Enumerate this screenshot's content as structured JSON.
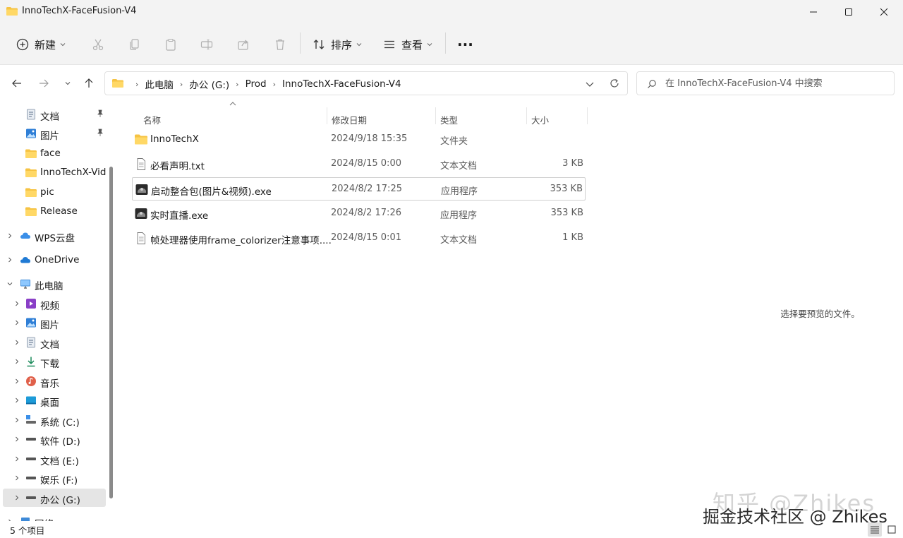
{
  "window": {
    "title": "InnoTechX-FaceFusion-V4",
    "minimize_icon": "minimize-icon",
    "maximize_icon": "maximize-icon",
    "close_icon": "close-icon"
  },
  "toolbar": {
    "new_label": "新建",
    "sort_label": "排序",
    "view_label": "查看",
    "more_label": "···"
  },
  "address": {
    "crumbs": [
      "此电脑",
      "办公 (G:)",
      "Prod",
      "InnoTechX-FaceFusion-V4"
    ],
    "search_placeholder": "在 InnoTechX-FaceFusion-V4 中搜索"
  },
  "sidebar": {
    "quick": [
      {
        "label": "文档",
        "icon": "documents-icon",
        "pinned": true
      },
      {
        "label": "图片",
        "icon": "pictures-icon",
        "pinned": true
      },
      {
        "label": "face",
        "icon": "folder-icon"
      },
      {
        "label": "InnoTechX-Vid",
        "icon": "folder-icon"
      },
      {
        "label": "pic",
        "icon": "folder-icon"
      },
      {
        "label": "Release",
        "icon": "folder-icon"
      }
    ],
    "wps": "WPS云盘",
    "onedrive": "OneDrive",
    "thispc": "此电脑",
    "pc_items": [
      {
        "label": "视频",
        "icon": "videos-icon"
      },
      {
        "label": "图片",
        "icon": "pictures-icon"
      },
      {
        "label": "文档",
        "icon": "documents-icon"
      },
      {
        "label": "下载",
        "icon": "downloads-icon"
      },
      {
        "label": "音乐",
        "icon": "music-icon"
      },
      {
        "label": "桌面",
        "icon": "desktop-icon"
      },
      {
        "label": "系统 (C:)",
        "icon": "system-drive-icon"
      },
      {
        "label": "软件 (D:)",
        "icon": "drive-icon"
      },
      {
        "label": "文档 (E:)",
        "icon": "drive-icon"
      },
      {
        "label": "娱乐 (F:)",
        "icon": "drive-icon"
      },
      {
        "label": "办公 (G:)",
        "icon": "drive-icon",
        "selected": true
      },
      {
        "label": "网络",
        "icon": "network-icon"
      }
    ]
  },
  "columns": {
    "name": "名称",
    "date": "修改日期",
    "type": "类型",
    "size": "大小"
  },
  "files": [
    {
      "name": "InnoTechX",
      "date": "2024/9/18 15:35",
      "type": "文件夹",
      "size": "",
      "icon": "folder-icon"
    },
    {
      "name": "必看声明.txt",
      "date": "2024/8/15 0:00",
      "type": "文本文档",
      "size": "3 KB",
      "icon": "text-file-icon"
    },
    {
      "name": "启动整合包(图片&视频).exe",
      "date": "2024/8/2 17:25",
      "type": "应用程序",
      "size": "353 KB",
      "icon": "app-icon"
    },
    {
      "name": "实时直播.exe",
      "date": "2024/8/2 17:26",
      "type": "应用程序",
      "size": "353 KB",
      "icon": "app-icon"
    },
    {
      "name": "帧处理器使用frame_colorizer注意事项....",
      "date": "2024/8/15 0:01",
      "type": "文本文档",
      "size": "1 KB",
      "icon": "text-file-icon"
    }
  ],
  "preview": {
    "message": "选择要预览的文件。"
  },
  "status": {
    "count": "5 个项目"
  },
  "watermark": {
    "line1": "知乎 @Zhikes",
    "line2": "掘金技术社区 @ Zhikes"
  },
  "colors": {
    "folder": "#f6c343",
    "accent": "#0067c0",
    "selected_bg": "#e5e5e5"
  }
}
